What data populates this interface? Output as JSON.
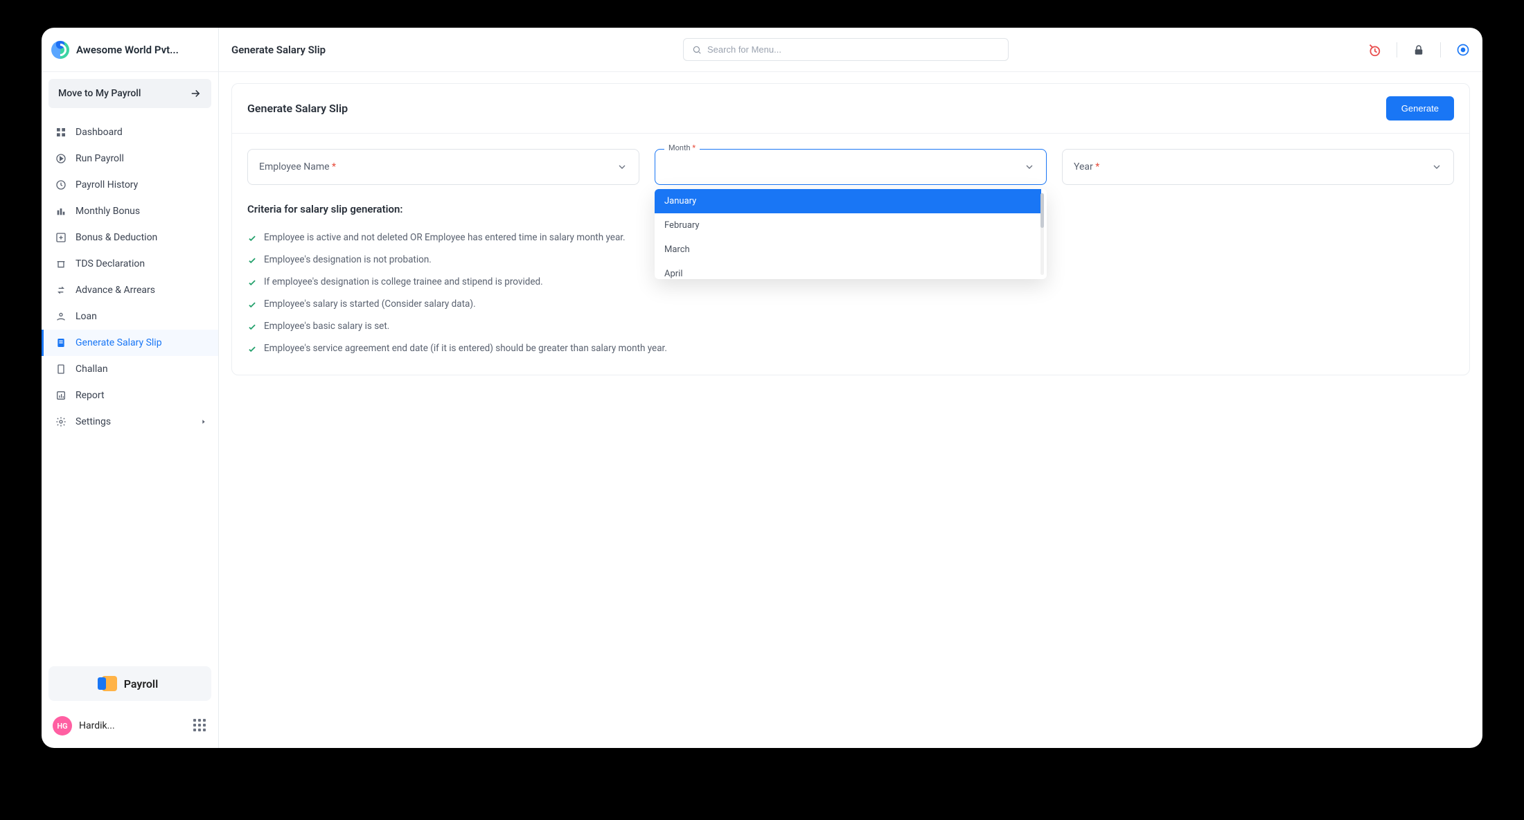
{
  "brand": {
    "name": "Awesome World Pvt..."
  },
  "move_row": {
    "label": "Move to My Payroll"
  },
  "sidebar": {
    "items": [
      {
        "label": "Dashboard"
      },
      {
        "label": "Run Payroll"
      },
      {
        "label": "Payroll History"
      },
      {
        "label": "Monthly Bonus"
      },
      {
        "label": "Bonus & Deduction"
      },
      {
        "label": "TDS Declaration"
      },
      {
        "label": "Advance & Arrears"
      },
      {
        "label": "Loan"
      },
      {
        "label": "Generate Salary Slip"
      },
      {
        "label": "Challan"
      },
      {
        "label": "Report"
      },
      {
        "label": "Settings"
      }
    ],
    "module": "Payroll",
    "user": {
      "initials": "HG",
      "name": "Hardik..."
    }
  },
  "topbar": {
    "breadcrumb": "Generate Salary Slip",
    "search_placeholder": "Search for Menu..."
  },
  "page": {
    "title": "Generate Salary Slip",
    "generate_btn": "Generate",
    "fields": {
      "employee_label": "Employee Name",
      "month_label": "Month",
      "year_label": "Year"
    },
    "month_options": [
      "January",
      "February",
      "March",
      "April"
    ],
    "criteria_title": "Criteria for salary slip generation:",
    "criteria": [
      "Employee is active and not deleted OR Employee has entered time in salary month year.",
      "Employee's designation is not probation.",
      "If employee's designation is college trainee and stipend is provided.",
      "Employee's salary is started (Consider salary data).",
      "Employee's basic salary is set.",
      "Employee's service agreement end date (if it is entered) should be greater than salary month year."
    ]
  }
}
